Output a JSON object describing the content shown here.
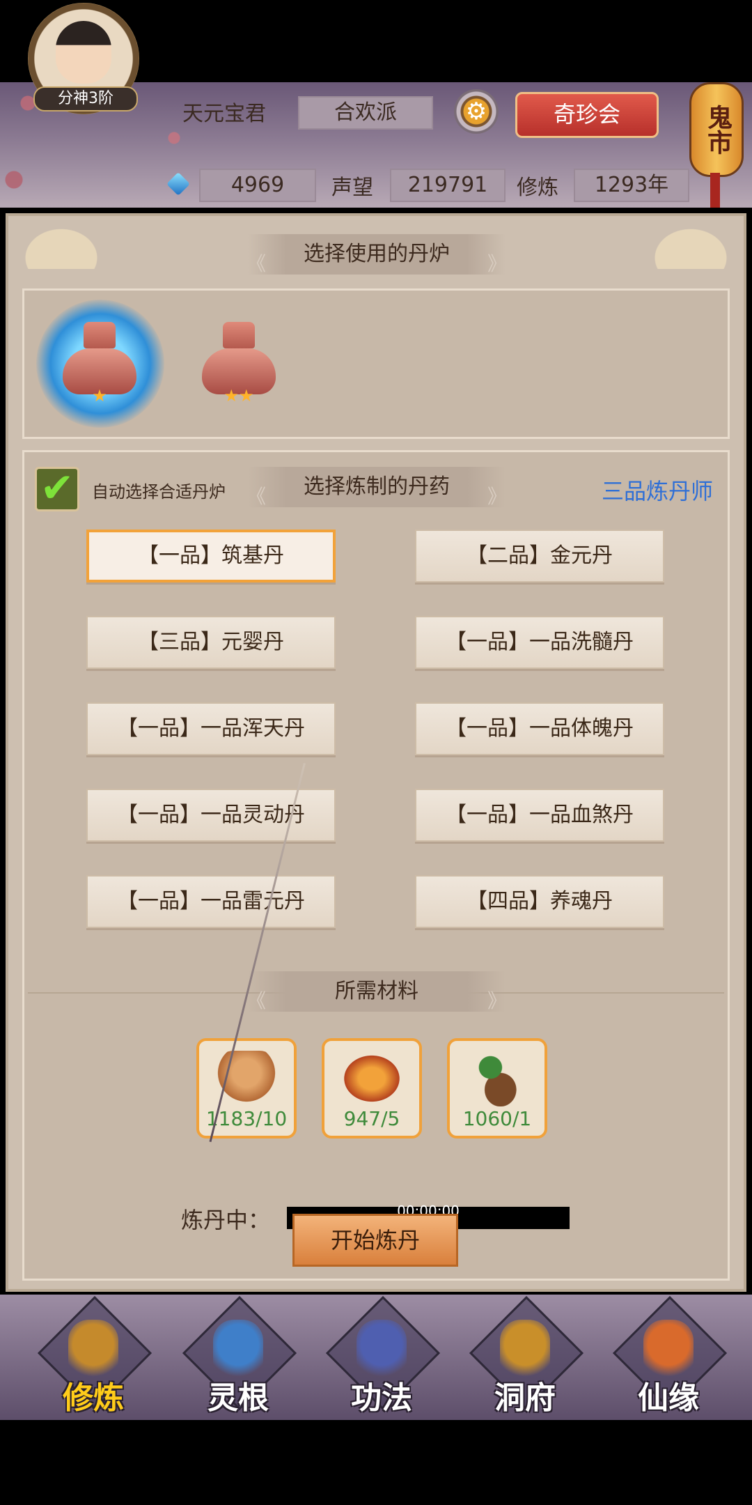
{
  "header": {
    "player_name": "天元宝君",
    "sect": "合欢派",
    "realm_badge": "分神3阶",
    "gear_icon": "gear-icon",
    "qizhen_button": "奇珍会",
    "lantern": "鬼市",
    "stats": {
      "gems": "4969",
      "reputation_label": "声望",
      "reputation": "219791",
      "cultivation_label": "修炼",
      "cultivation": "1293年"
    }
  },
  "furnace_section": {
    "title": "选择使用的丹炉",
    "furnaces": [
      {
        "stars": "★",
        "selected": true
      },
      {
        "stars": "★★",
        "selected": false
      }
    ]
  },
  "recipe_section": {
    "title": "选择炼制的丹药",
    "auto_select_label": "自动选择合适丹炉",
    "auto_select_checked": true,
    "alchemist_rank": "三品炼丹师",
    "pills": [
      {
        "label": "【一品】筑基丹",
        "selected": true
      },
      {
        "label": "【二品】金元丹",
        "selected": false
      },
      {
        "label": "【三品】元婴丹",
        "selected": false
      },
      {
        "label": "【一品】一品洗髓丹",
        "selected": false
      },
      {
        "label": "【一品】一品浑天丹",
        "selected": false
      },
      {
        "label": "【一品】一品体魄丹",
        "selected": false
      },
      {
        "label": "【一品】一品灵动丹",
        "selected": false
      },
      {
        "label": "【一品】一品血煞丹",
        "selected": false
      },
      {
        "label": "【一品】一品雷元丹",
        "selected": false
      },
      {
        "label": "【四品】养魂丹",
        "selected": false
      }
    ]
  },
  "materials_section": {
    "title": "所需材料",
    "materials": [
      {
        "icon": "ginseng-icon",
        "count": "1183/10"
      },
      {
        "icon": "cordyceps-icon",
        "count": "947/5"
      },
      {
        "icon": "herb-root-icon",
        "count": "1060/1"
      }
    ]
  },
  "refining": {
    "label": "炼丹中：",
    "time": "00:00:00",
    "progress": 0,
    "start_button": "开始炼丹"
  },
  "nav": [
    {
      "label": "修炼",
      "active": true,
      "color": "#c58a2c"
    },
    {
      "label": "灵根",
      "active": false,
      "color": "#3f7fc9"
    },
    {
      "label": "功法",
      "active": false,
      "color": "#4f5fb0"
    },
    {
      "label": "洞府",
      "active": false,
      "color": "#c98f2a"
    },
    {
      "label": "仙缘",
      "active": false,
      "color": "#d96a2c"
    }
  ]
}
